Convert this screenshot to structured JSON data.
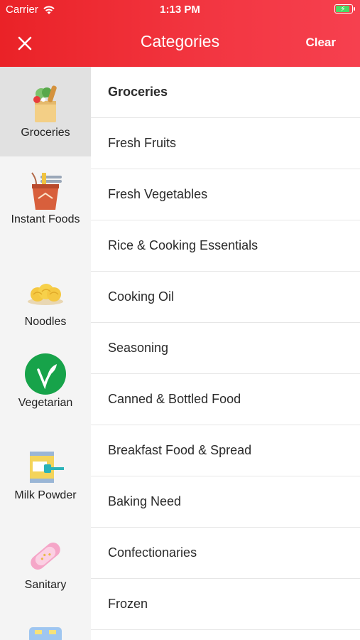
{
  "status": {
    "carrier": "Carrier",
    "time": "1:13 PM"
  },
  "nav": {
    "title": "Categories",
    "clear_label": "Clear"
  },
  "sidebar": {
    "items": [
      {
        "label": "Groceries",
        "icon": "grocery-bag-icon",
        "active": true
      },
      {
        "label": "Instant Foods",
        "icon": "instant-noodle-cup-icon"
      },
      {
        "label": "Noodles",
        "icon": "noodles-icon"
      },
      {
        "label": "Vegetarian",
        "icon": "vegetarian-leaf-icon"
      },
      {
        "label": "Milk Powder",
        "icon": "milk-powder-can-icon"
      },
      {
        "label": "Sanitary",
        "icon": "sanitary-pad-icon"
      }
    ]
  },
  "list": {
    "items": [
      "Groceries",
      "Fresh Fruits",
      "Fresh Vegetables",
      "Rice & Cooking Essentials",
      "Cooking Oil",
      "Seasoning",
      "Canned & Bottled Food",
      "Breakfast Food & Spread",
      "Baking Need",
      "Confectionaries",
      "Frozen"
    ]
  },
  "colors": {
    "header": "#ee2a31",
    "accent_green": "#17a34a",
    "battery": "#4cd964"
  }
}
